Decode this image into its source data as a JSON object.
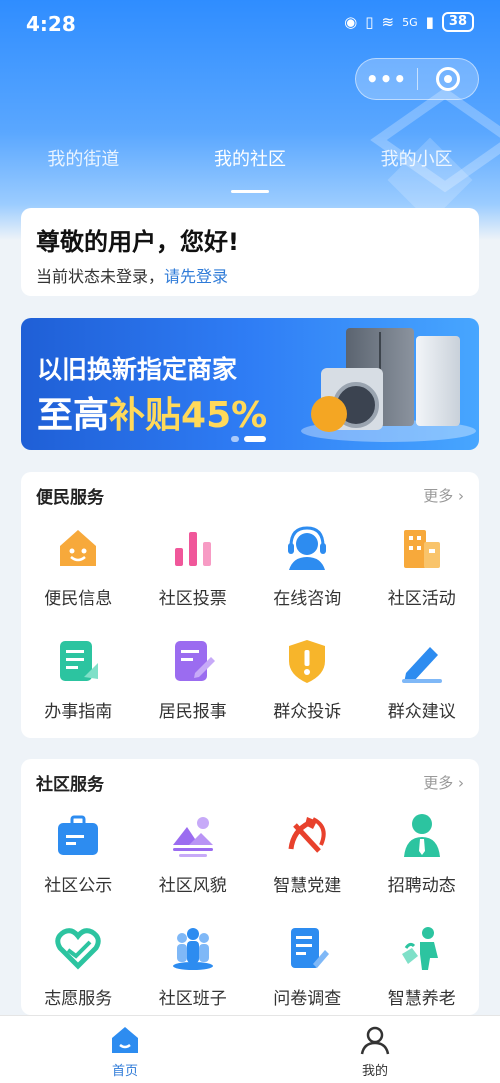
{
  "status": {
    "time": "4:28",
    "signal": "5G",
    "battery": "38"
  },
  "capsule": {
    "more_icon": "dots-icon",
    "close_icon": "target-icon"
  },
  "tabs": [
    {
      "label": "我的街道"
    },
    {
      "label": "我的社区"
    },
    {
      "label": "我的小区"
    }
  ],
  "welcome": {
    "greeting": "尊敬的用户，您好!",
    "status_text": "当前状态未登录，",
    "login_link": "请先登录"
  },
  "banner": {
    "line1": "以旧换新指定商家",
    "line2_prefix": "至高",
    "line2_highlight": "补贴45%"
  },
  "convenience": {
    "title": "便民服务",
    "more": "更多 ›",
    "items": [
      {
        "label": "便民信息",
        "icon": "house-smile-icon",
        "color": "#f7a93b"
      },
      {
        "label": "社区投票",
        "icon": "bar-chart-icon",
        "color": "#f0579a"
      },
      {
        "label": "在线咨询",
        "icon": "headset-icon",
        "color": "#2d8cf0"
      },
      {
        "label": "社区活动",
        "icon": "building-icon",
        "color": "#f7a93b"
      },
      {
        "label": "办事指南",
        "icon": "guide-doc-icon",
        "color": "#2cc4a0"
      },
      {
        "label": "居民报事",
        "icon": "report-edit-icon",
        "color": "#9b6cf0"
      },
      {
        "label": "群众投诉",
        "icon": "shield-alert-icon",
        "color": "#f7b52b"
      },
      {
        "label": "群众建议",
        "icon": "pencil-icon",
        "color": "#2d8cf0"
      }
    ]
  },
  "community": {
    "title": "社区服务",
    "more": "更多 ›",
    "items": [
      {
        "label": "社区公示",
        "icon": "briefcase-icon",
        "color": "#2d8cf0"
      },
      {
        "label": "社区风貌",
        "icon": "landscape-icon",
        "color": "#9b6cf0"
      },
      {
        "label": "智慧党建",
        "icon": "party-emblem-icon",
        "color": "#e8412c"
      },
      {
        "label": "招聘动态",
        "icon": "person-tie-icon",
        "color": "#2cc4a0"
      },
      {
        "label": "志愿服务",
        "icon": "heart-hand-icon",
        "color": "#2cc4a0"
      },
      {
        "label": "社区班子",
        "icon": "group-icon",
        "color": "#2d8cf0"
      },
      {
        "label": "问卷调查",
        "icon": "survey-icon",
        "color": "#2d8cf0"
      },
      {
        "label": "智慧养老",
        "icon": "elder-care-icon",
        "color": "#2cc4a0"
      }
    ]
  },
  "nav": [
    {
      "label": "首页",
      "icon": "home-icon",
      "active": true
    },
    {
      "label": "我的",
      "icon": "user-icon",
      "active": false
    }
  ],
  "colors": {
    "primary": "#2f7bd8",
    "hero": "#2f8dff"
  }
}
